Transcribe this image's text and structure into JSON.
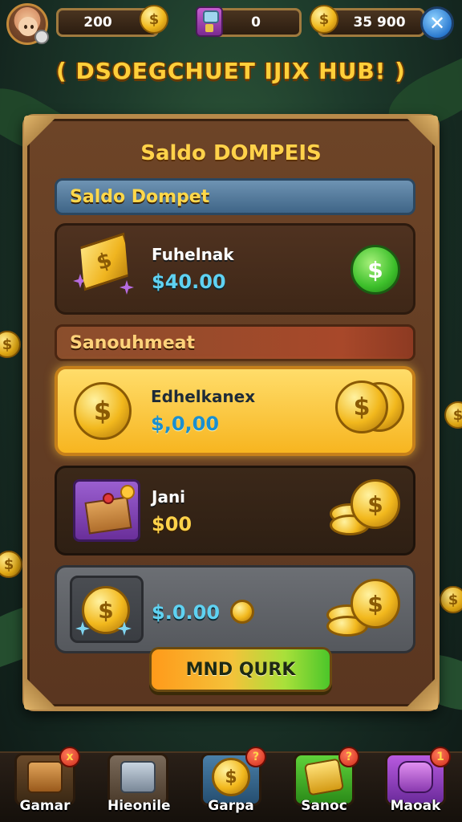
{
  "hud": {
    "coins": "200",
    "gems": "0",
    "extra": "35 900",
    "coin_symbol": "$"
  },
  "hub_title": "( DSOEGCHUET IJIX HUB! )",
  "panel": {
    "title": "Saldo DOMPEIS",
    "section_wallet": "Saldo Dompet",
    "section_other": "Sanouhmeat",
    "items": [
      {
        "name": "Fuhelnak",
        "amount": "$40.00",
        "icon": "gold-gem-icon"
      },
      {
        "name": "Edhelkanex",
        "amount": "$,0,00",
        "icon": "gold-coin-icon"
      },
      {
        "name": "Jani",
        "amount": "$00",
        "icon": "gift-box-icon"
      },
      {
        "name": "",
        "amount": "$.0.00",
        "icon": "silver-coin-icon"
      }
    ],
    "cta_label": "MND QURK"
  },
  "nav": {
    "items": [
      {
        "label": "Gamar",
        "badge": "x",
        "icon": "crate-icon",
        "color": "#b06a2a"
      },
      {
        "label": "Hieonile",
        "badge": "",
        "icon": "chest-icon",
        "color": "#9aa8b8"
      },
      {
        "label": "Garpa",
        "badge": "?",
        "icon": "coin-icon",
        "color": "#3a6f9a"
      },
      {
        "label": "Sanoc",
        "badge": "?",
        "icon": "gold-bar-icon",
        "color": "#3fae2a"
      },
      {
        "label": "Maoak",
        "badge": "1",
        "icon": "gem-icon",
        "color": "#a03ad0"
      }
    ]
  },
  "colors": {
    "panel_wood": "#6d4427",
    "gold": "#ffd24a",
    "cyan_amount": "#5fd2f2",
    "accent_green": "#3cbf2a"
  }
}
